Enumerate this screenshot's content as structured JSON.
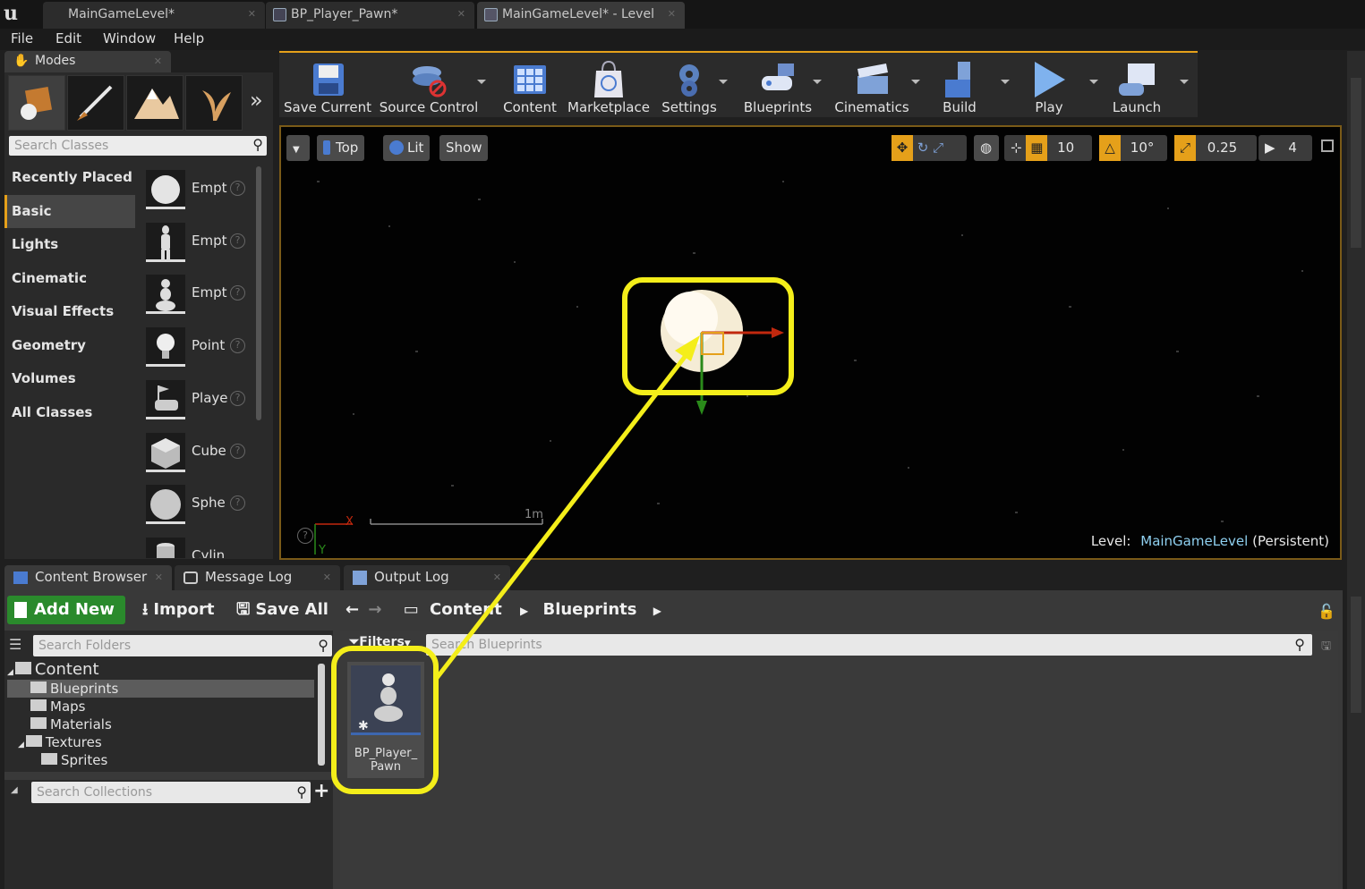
{
  "tabs": [
    {
      "label": "MainGameLevel*",
      "active": false
    },
    {
      "label": "BP_Player_Pawn*",
      "active": false
    },
    {
      "label": "MainGameLevel* - Level",
      "active": true
    }
  ],
  "menu": [
    "File",
    "Edit",
    "Window",
    "Help"
  ],
  "modes": {
    "tab_label": "Modes",
    "search_placeholder": "Search Classes",
    "categories": [
      "Recently Placed",
      "Basic",
      "Lights",
      "Cinematic",
      "Visual Effects",
      "Geometry",
      "Volumes",
      "All Classes"
    ],
    "selected_category": "Basic",
    "items": [
      "Empt",
      "Empt",
      "Empt",
      "Point",
      "Playe",
      "Cube",
      "Sphe",
      "Cylin"
    ]
  },
  "toolbar": {
    "buttons": [
      "Save Current",
      "Source Control",
      "Content",
      "Marketplace",
      "Settings",
      "Blueprints",
      "Cinematics",
      "Build",
      "Play",
      "Launch"
    ]
  },
  "viewport": {
    "view_label": "Top",
    "lit_label": "Lit",
    "show_label": "Show",
    "grid_snap": "10",
    "rot_snap": "10°",
    "scale_snap": "0.25",
    "cam_speed": "4",
    "scale_text": "1m",
    "axis_x": "X",
    "axis_y": "Y",
    "level_prefix": "Level:",
    "level_name": "MainGameLevel",
    "level_suffix": "(Persistent)"
  },
  "bottom_tabs": [
    "Content Browser",
    "Message Log",
    "Output Log"
  ],
  "content_browser": {
    "add_new": "Add New",
    "import": "Import",
    "save_all": "Save All",
    "path": [
      "Content",
      "Blueprints"
    ],
    "search_folders": "Search Folders",
    "tree": [
      {
        "label": "Content",
        "level": 0
      },
      {
        "label": "Blueprints",
        "level": 1
      },
      {
        "label": "Maps",
        "level": 1
      },
      {
        "label": "Materials",
        "level": 1
      },
      {
        "label": "Textures",
        "level": 1
      },
      {
        "label": "Sprites",
        "level": 2
      }
    ],
    "search_collections": "Search Collections",
    "filters_label": "Filters",
    "search_assets": "Search Blueprints",
    "asset_name_line1": "BP_Player_",
    "asset_name_line2": "Pawn"
  },
  "colors": {
    "highlight": "#f4ee1a",
    "accent": "#e5a01a",
    "add_new": "#2a8a2c",
    "level_name": "#8fd0f0"
  }
}
